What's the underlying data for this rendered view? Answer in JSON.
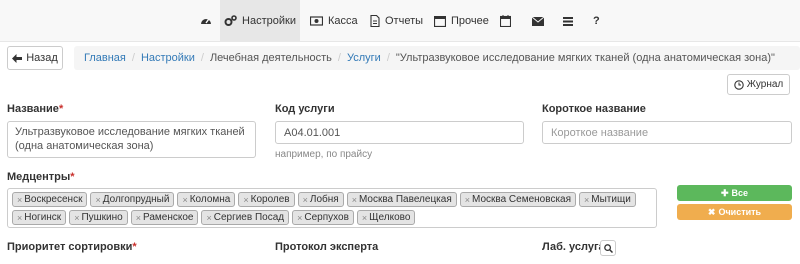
{
  "nav": {
    "items": [
      {
        "icon": "dashboard-icon",
        "label": ""
      },
      {
        "icon": "cogs-icon",
        "label": "Настройки"
      },
      {
        "icon": "cash-icon",
        "label": "Касса"
      },
      {
        "icon": "file-icon",
        "label": "Отчеты"
      },
      {
        "icon": "window-icon",
        "label": "Прочее"
      },
      {
        "icon": "calendar-icon",
        "label": ""
      },
      {
        "icon": "envelope-icon",
        "label": ""
      },
      {
        "icon": "bars-icon",
        "label": ""
      },
      {
        "icon": "help-icon",
        "label": "?"
      }
    ],
    "active_index": 1
  },
  "back_label": "Назад",
  "breadcrumb": [
    {
      "text": "Главная",
      "link": true
    },
    {
      "text": "Настройки",
      "link": true
    },
    {
      "text": "Лечебная деятельность",
      "link": false
    },
    {
      "text": "Услуги",
      "link": true
    },
    {
      "text": "\"Ультразвуковое исследование мягких тканей (одна анатомическая зона)\"",
      "link": false
    }
  ],
  "journal_label": "Журнал",
  "form": {
    "name": {
      "label": "Название",
      "value": "Ультразвуковое исследование мягких тканей (одна анатомическая зона)"
    },
    "code": {
      "label": "Код услуги",
      "value": "A04.01.001",
      "help": "например, по прайсу"
    },
    "short_name": {
      "label": "Короткое название",
      "placeholder": "Короткое название"
    },
    "medcenters": {
      "label": "Медцентры",
      "tags": [
        "Воскресенск",
        "Долгопрудный",
        "Коломна",
        "Королев",
        "Лобня",
        "Москва Павелецкая",
        "Москва Семеновская",
        "Мытищи",
        "Ногинск",
        "Пушкино",
        "Раменское",
        "Сергиев Посад",
        "Серпухов",
        "Щелково"
      ],
      "btn_all": "Все",
      "btn_clear": "Очистить"
    },
    "sort_priority": {
      "label": "Приоритет сортировки"
    },
    "expert_protocol": {
      "label": "Протокол эксперта"
    },
    "lab_service": {
      "label": "Лаб. услуга"
    }
  },
  "colors": {
    "link": "#337ab7",
    "success": "#5cb85c",
    "warning": "#f0ad4e",
    "required": "#c9302c"
  }
}
